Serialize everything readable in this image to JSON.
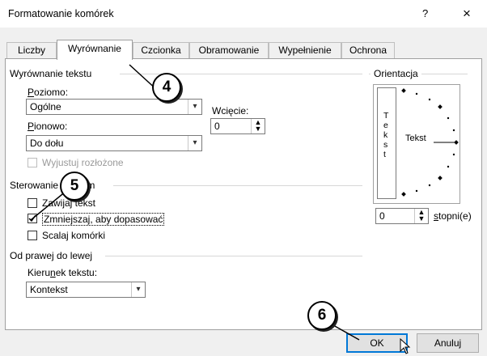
{
  "window": {
    "title": "Formatowanie komórek",
    "help": "?",
    "close": "×"
  },
  "tabs": [
    {
      "label": "Liczby",
      "active": false
    },
    {
      "label": "Wyrównanie",
      "active": true
    },
    {
      "label": "Czcionka",
      "active": false
    },
    {
      "label": "Obramowanie",
      "active": false
    },
    {
      "label": "Wypełnienie",
      "active": false
    },
    {
      "label": "Ochrona",
      "active": false
    }
  ],
  "alignment": {
    "group_label": "Wyrównanie tekstu",
    "horizontal_label": "Poziomo:",
    "horizontal_value": "Ogólne",
    "vertical_label": "Pionowo:",
    "vertical_value": "Do dołu",
    "indent_label": "Wcięcie:",
    "indent_value": "0",
    "justify_distributed": {
      "label": "Wyjustuj rozłożone",
      "checked": false,
      "enabled": false
    }
  },
  "text_control": {
    "group_label": "Sterowanie tekstem",
    "wrap_text": {
      "label": "Zawijaj tekst",
      "checked": false
    },
    "shrink_to_fit": {
      "label": "Zmniejszaj, aby dopasować",
      "checked": true
    },
    "merge_cells": {
      "label": "Scalaj komórki",
      "checked": false
    }
  },
  "rtl": {
    "group_label": "Od prawej do lewej",
    "direction_label": "Kierunek tekstu:",
    "direction_value": "Kontekst"
  },
  "orientation": {
    "group_label": "Orientacja",
    "vertical_text": [
      "T",
      "e",
      "k",
      "s",
      "t"
    ],
    "dial_text": "Tekst",
    "degrees_value": "0",
    "degrees_label": "stopni(e)"
  },
  "buttons": {
    "ok": "OK",
    "cancel": "Anuluj"
  },
  "callouts": {
    "c4": "4",
    "c5": "5",
    "c6": "6"
  }
}
